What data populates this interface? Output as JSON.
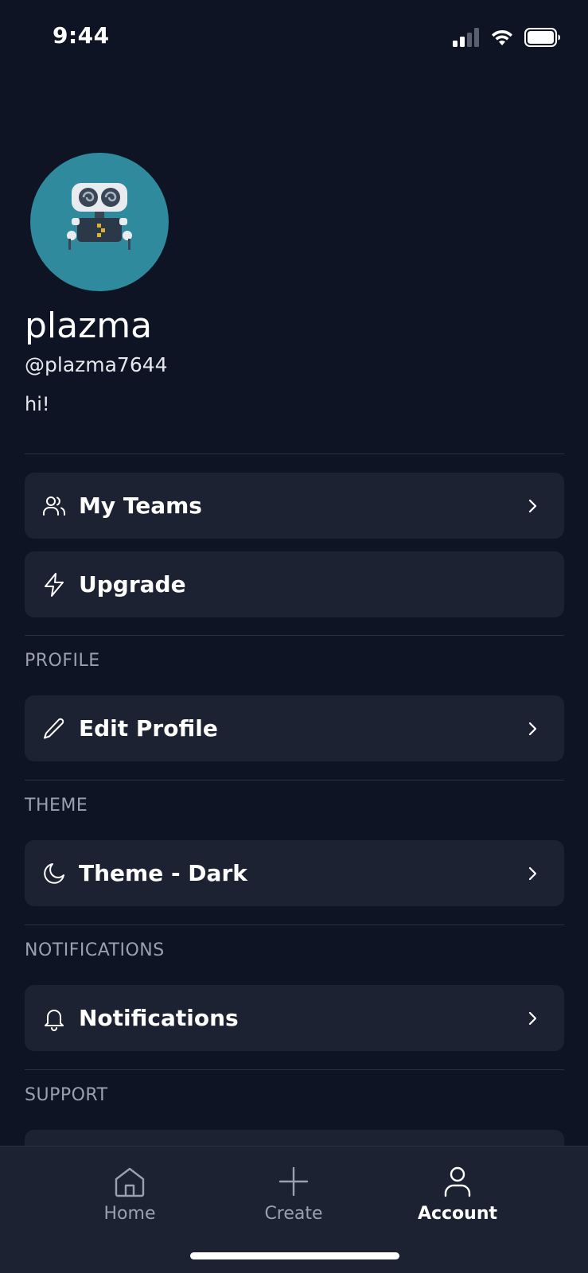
{
  "status": {
    "time": "9:44"
  },
  "profile": {
    "display_name": "plazma",
    "username": "@plazma7644",
    "bio": "hi!"
  },
  "menu": {
    "my_teams": "My Teams",
    "upgrade": "Upgrade",
    "edit_profile": "Edit Profile",
    "theme": "Theme - Dark",
    "notifications": "Notifications"
  },
  "sections": {
    "profile": "PROFILE",
    "theme": "THEME",
    "notifications": "NOTIFICATIONS",
    "support": "SUPPORT"
  },
  "tabs": {
    "home": "Home",
    "create": "Create",
    "account": "Account",
    "active": "account"
  },
  "colors": {
    "background": "#0f1424",
    "card": "#1d2233",
    "avatar_bg": "#2e8a9c",
    "muted_text": "#9aa0ae"
  }
}
